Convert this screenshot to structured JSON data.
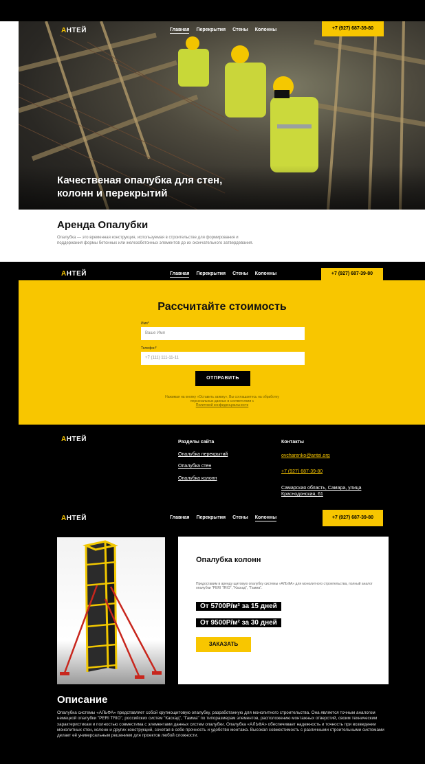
{
  "brand": {
    "logo_a": "А",
    "logo_rest": "НТЕЙ"
  },
  "nav": {
    "items": [
      "Главная",
      "Перекрытия",
      "Стены",
      "Колонны"
    ],
    "phone": "+7 (927) 687-39-80"
  },
  "hero": {
    "title_line1": "Качественая опалубка для стен,",
    "title_line2": "колонн и перекрытий"
  },
  "rent": {
    "title": "Аренда Опалубки",
    "text": "Опалубка — это временная конструкция, используемая в строительстве для формирования и поддержания формы бетонных или железобетонных элементов до их окончательного затвердевания."
  },
  "calc": {
    "title": "Рассчитайте стоимость",
    "name_label": "Имя*",
    "name_placeholder": "Ваше Имя",
    "phone_label": "Телефон*",
    "phone_placeholder": "+7 (111) 111-11-11",
    "submit": "ОТПРАВИТЬ",
    "consent_line1": "Нажимая на кнопку «Оставить заявку», Вы соглашаетесь на обработку",
    "consent_line2": "персональных данных в соответствии с",
    "consent_link": "Политикой конфиденциальности"
  },
  "footer": {
    "sections_title": "Разделы сайта",
    "sections": [
      "Опалубка перекрытий",
      "Опалубка стен",
      "Опалубка колонн"
    ],
    "contacts_title": "Контакты",
    "email": "ovcharenko@antei.org",
    "phone": "+7 (927) 687-39-80",
    "address_line1": "Самарская область, Самара, улица",
    "address_line2": "Краснодонская, 61"
  },
  "product": {
    "title": "Опалубка колонн",
    "desc": "Предоставим в аренду щитовую опалубку системы «АЛЬФА» для монолитного строительства, полный аналог опалубки \"PERI TRIO\", \"Каскад\", \"Гамма\".",
    "price1": "От 5700Р/м² за 15 дней",
    "price2": "От 9500Р/м² за 30 дней",
    "order": "ЗАКАЗАТЬ"
  },
  "description": {
    "title": "Описание",
    "text": "Опалубка системы «АЛЬФА» представляет собой крупнощитовую опалубку, разработанную для монолитного строительства. Она является точным аналогом немецкой опалубки \"PERI TRIO\", российских систем \"Каскад\", \"Гамма\" по типоразмерам элементов, расположению монтажных отверстий, своим техническим характеристикам и полностью совместима с элементами данных систем опалубки. Опалубка «АЛЬФА» обеспечивает надежность и точность при возведении монолитных стен, колонн и других конструкций, сочетая в себе прочность и удобство монтажа. Высокая совместимость с различными строительными системами делает её универсальным решением для проектов любой сложности."
  },
  "colors": {
    "accent": "#f8c600",
    "dark": "#000000"
  }
}
